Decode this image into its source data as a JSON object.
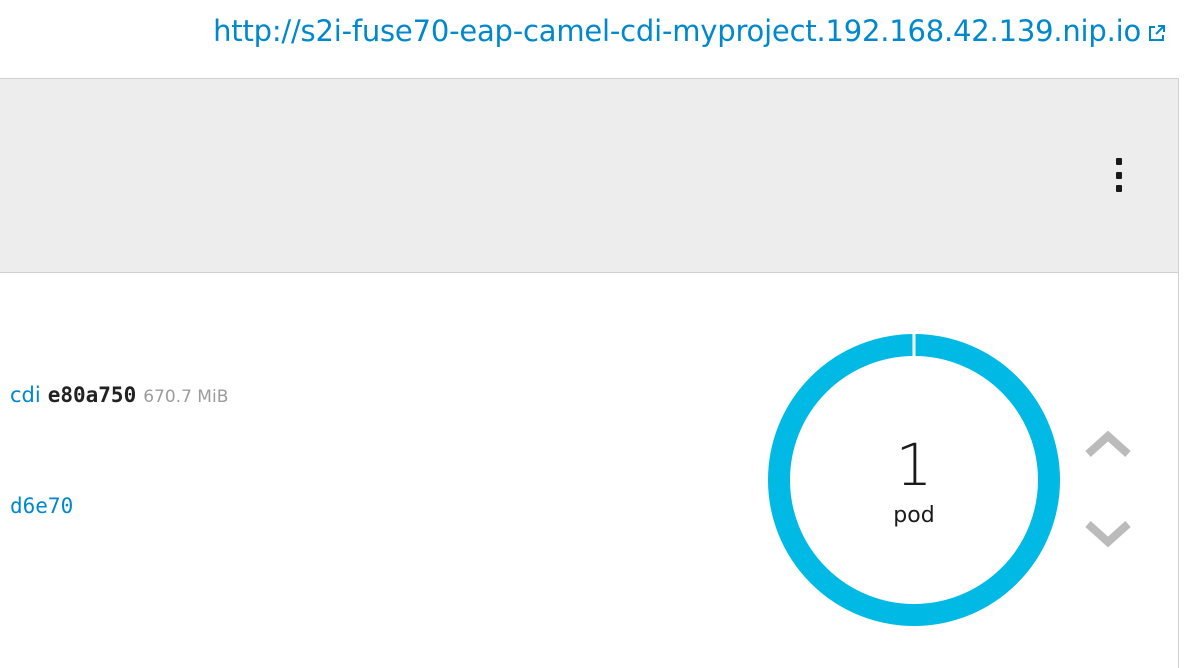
{
  "route": {
    "url": "http://s2i-fuse70-eap-camel-cdi-myproject.192.168.42.139.nip.io",
    "icon": "external-link-icon"
  },
  "deployment": {
    "name_fragment": "cdi",
    "image_id": "e80a750",
    "image_size": "670.7 MiB",
    "commit_fragment": "d6e70"
  },
  "pods": {
    "count": "1",
    "unit": "pod",
    "ring_color": "#00b9e4"
  },
  "actions": {
    "menu_icon": "kebab-menu-icon",
    "scale_up_icon": "chevron-up-icon",
    "scale_down_icon": "chevron-down-icon"
  },
  "colors": {
    "link": "#0088ce",
    "header_bg": "#ededed",
    "chevron": "#bbbbbb"
  }
}
